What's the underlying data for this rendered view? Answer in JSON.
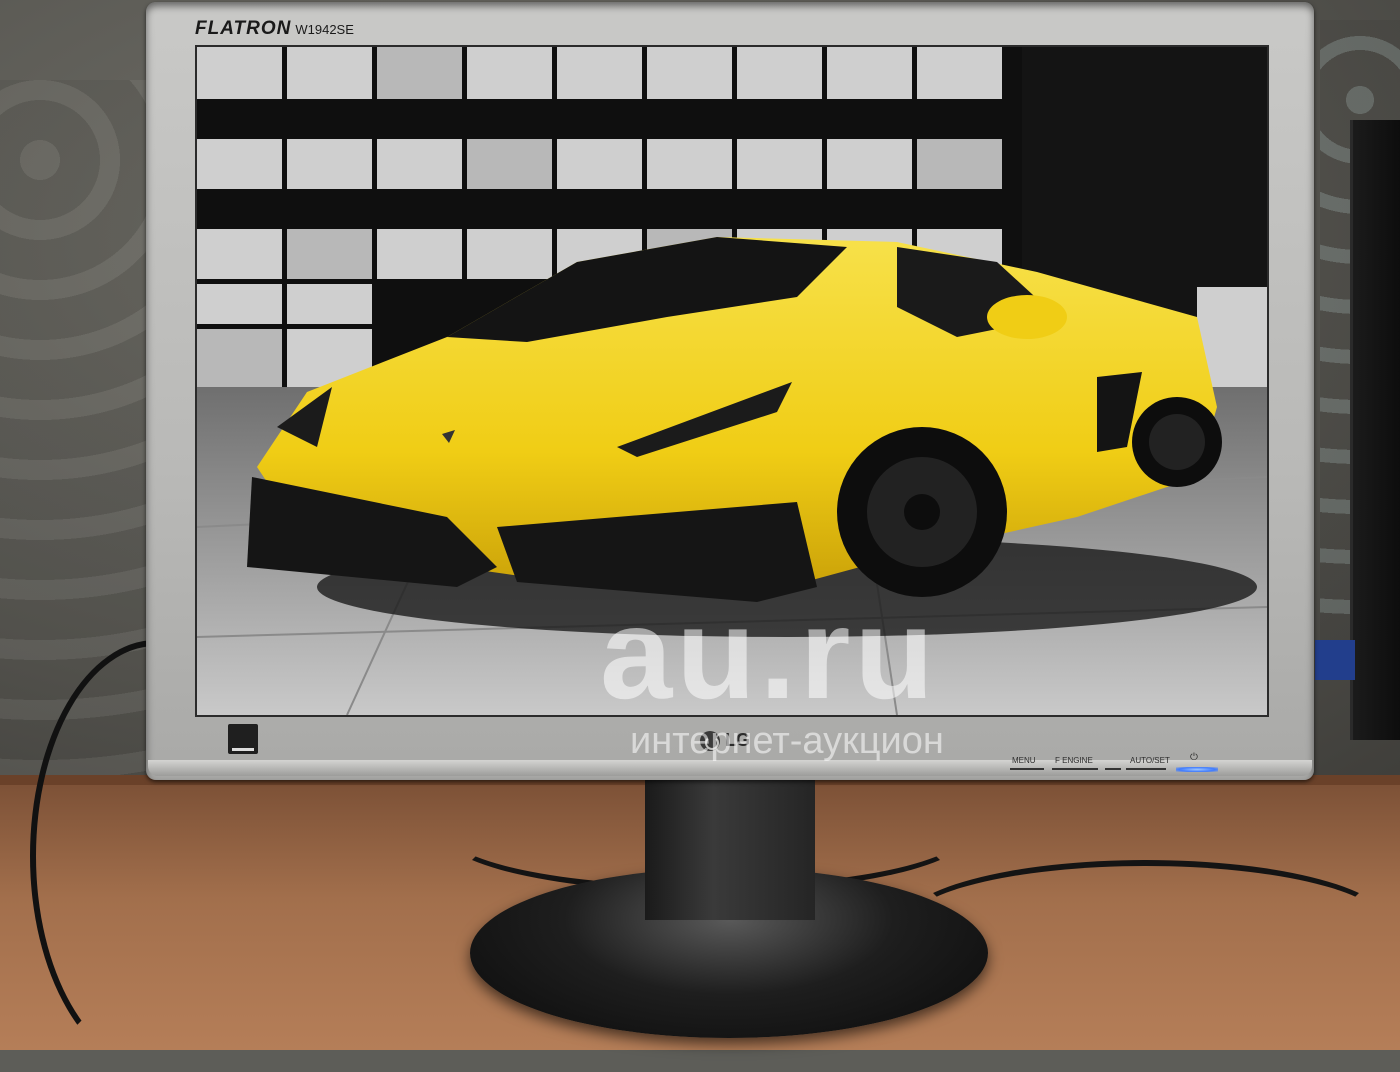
{
  "monitor": {
    "brand": "FLATRON",
    "model": "W1942SE",
    "logo_text": "LG",
    "controls": [
      "MENU",
      "f ENGINE",
      "AUTO/SET"
    ],
    "power_led_color": "#3f7bff"
  },
  "watermark": {
    "main": "au.ru",
    "sub": "интернет-аукцион"
  },
  "colors": {
    "car": "#f2d320",
    "bezel": "#c0c0be",
    "desk": "#a26f4c"
  }
}
